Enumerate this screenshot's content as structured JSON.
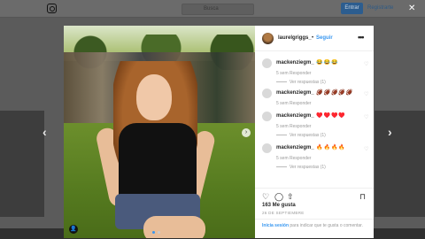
{
  "topbar": {
    "search_placeholder": "Busca",
    "login_label": "Entrar",
    "signup_label": "Registrarte"
  },
  "post": {
    "username": "laurelgriggs_",
    "separator": "•",
    "follow_label": "Seguir",
    "more_label": "•••",
    "likes": "163 Me gusta",
    "date": "26 DE SEPTIEMBRE"
  },
  "comments": [
    {
      "user": "mackenziegm_",
      "text": "😂😂😂",
      "time": "5 sem",
      "reply": "Responder",
      "replies": "Ver respuestas (1)"
    },
    {
      "user": "mackenziegm_",
      "text": "🏈🏈🏈🏈🏈",
      "time": "5 sem",
      "reply": "Responder",
      "replies": ""
    },
    {
      "user": "mackenziegm_",
      "text": "♥️♥️♥️♥️",
      "time": "5 sem",
      "reply": "Responder",
      "replies": "Ver respuestas (1)"
    },
    {
      "user": "mackenziegm_",
      "text": "🔥🔥🔥🔥",
      "time": "5 sem",
      "reply": "Responder",
      "replies": "Ver respuestas (1)"
    }
  ],
  "login_prompt": {
    "link": "Inicia sesión",
    "text": " para indicar que te gusta o comentar."
  },
  "icons": {
    "heart": "♡",
    "comment": "◯",
    "share": "⇧",
    "bookmark": "⊓",
    "prev": "‹",
    "next": "›",
    "close": "✕"
  }
}
